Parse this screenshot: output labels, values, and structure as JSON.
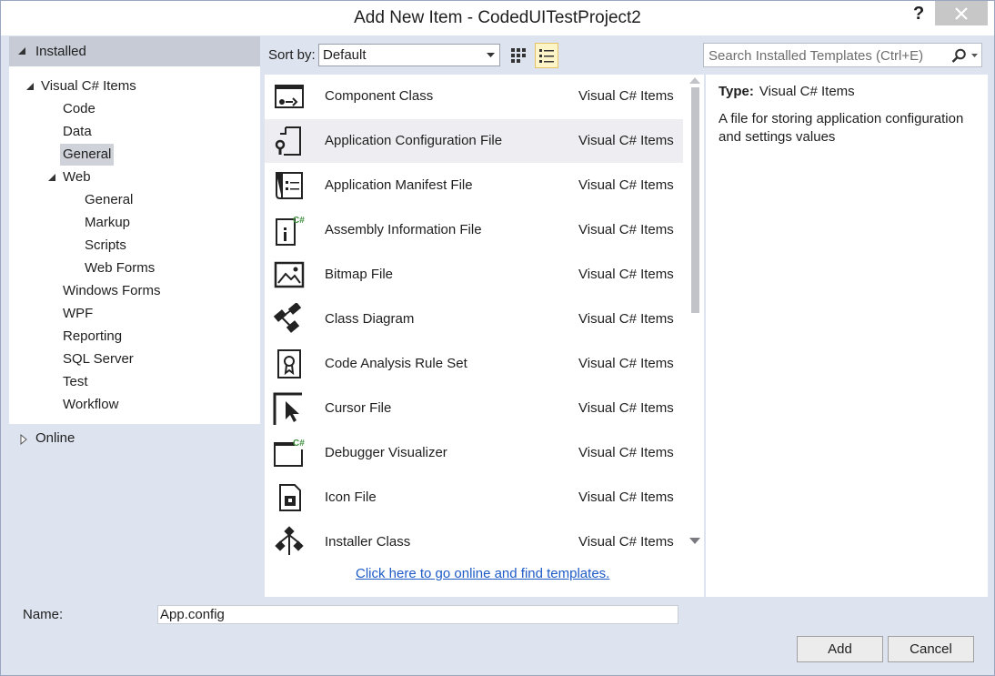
{
  "window": {
    "title": "Add New Item - CodedUITestProject2",
    "help_label": "?"
  },
  "tree": {
    "installed_label": "Installed",
    "nodes": [
      {
        "label": "Visual C# Items"
      },
      {
        "label": "Code"
      },
      {
        "label": "Data"
      },
      {
        "label": "General",
        "selected": true
      },
      {
        "label": "Web"
      },
      {
        "label": "General"
      },
      {
        "label": "Markup"
      },
      {
        "label": "Scripts"
      },
      {
        "label": "Web Forms"
      },
      {
        "label": "Windows Forms"
      },
      {
        "label": "WPF"
      },
      {
        "label": "Reporting"
      },
      {
        "label": "SQL Server"
      },
      {
        "label": "Test"
      },
      {
        "label": "Workflow"
      }
    ],
    "online_label": "Online"
  },
  "toolbar": {
    "sort_label": "Sort by:",
    "sort_value": "Default",
    "search_placeholder": "Search Installed Templates (Ctrl+E)"
  },
  "templates": [
    {
      "name": "Component Class",
      "lang": "Visual C# Items",
      "icon": "component-class-icon"
    },
    {
      "name": "Application Configuration File",
      "lang": "Visual C# Items",
      "icon": "config-file-icon",
      "selected": true
    },
    {
      "name": "Application Manifest File",
      "lang": "Visual C# Items",
      "icon": "manifest-file-icon"
    },
    {
      "name": "Assembly Information File",
      "lang": "Visual C# Items",
      "icon": "assembly-info-icon"
    },
    {
      "name": "Bitmap File",
      "lang": "Visual C# Items",
      "icon": "bitmap-file-icon"
    },
    {
      "name": "Class Diagram",
      "lang": "Visual C# Items",
      "icon": "class-diagram-icon"
    },
    {
      "name": "Code Analysis Rule Set",
      "lang": "Visual C# Items",
      "icon": "rule-set-icon"
    },
    {
      "name": "Cursor File",
      "lang": "Visual C# Items",
      "icon": "cursor-file-icon"
    },
    {
      "name": "Debugger Visualizer",
      "lang": "Visual C# Items",
      "icon": "debugger-visualizer-icon"
    },
    {
      "name": "Icon File",
      "lang": "Visual C# Items",
      "icon": "icon-file-icon"
    },
    {
      "name": "Installer Class",
      "lang": "Visual C# Items",
      "icon": "installer-class-icon"
    }
  ],
  "online_link": "Click here to go online and find templates.",
  "detail": {
    "type_label": "Type:",
    "type_value": "Visual C# Items",
    "description": "A file for storing application configuration and settings values"
  },
  "footer": {
    "name_label": "Name:",
    "name_value": "App.config",
    "add_label": "Add",
    "cancel_label": "Cancel"
  }
}
